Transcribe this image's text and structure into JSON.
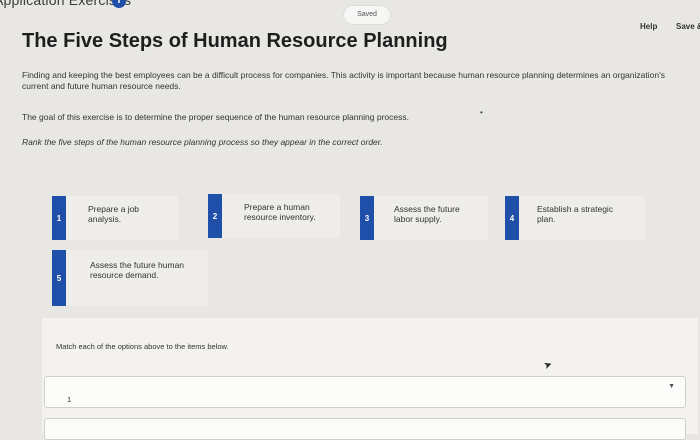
{
  "header": {
    "breadcrumb": "Application Exercises",
    "info_icon": "i",
    "saved_status": "Saved",
    "help_label": "Help",
    "save_exit_label": "Save &"
  },
  "main": {
    "title": "The Five Steps of Human Resource Planning",
    "intro": "Finding and keeping the best employees can be a difficult process for companies. This activity is important because human resource planning determines an organization's current and future human resource needs.",
    "goal": "The goal of this exercise is to determine the proper sequence of the human resource planning process.",
    "instruction": "Rank the five steps of the human resource planning process so they appear in the correct order."
  },
  "cards": [
    {
      "number": "1",
      "text": "Prepare a job analysis."
    },
    {
      "number": "2",
      "text": "Prepare a human resource inventory."
    },
    {
      "number": "3",
      "text": "Assess the future labor supply."
    },
    {
      "number": "4",
      "text": "Establish a strategic plan."
    },
    {
      "number": "5",
      "text": "Assess the future human resource demand."
    }
  ],
  "match": {
    "label": "Match each of the options above to the items below.",
    "items": [
      {
        "number": "1"
      }
    ]
  },
  "colors": {
    "accent": "#1f4fa8",
    "page_bg": "#e8e7e4"
  }
}
